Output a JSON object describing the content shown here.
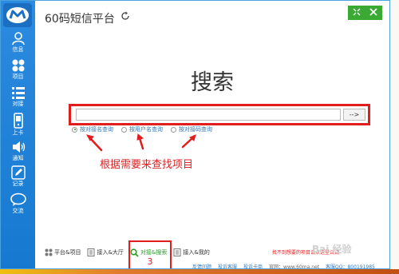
{
  "app": {
    "title": "60码短信平台"
  },
  "sidebar": {
    "items": [
      {
        "label": "信息",
        "icon": "user-icon"
      },
      {
        "label": "项目",
        "icon": "grid-icon"
      },
      {
        "label": "对接",
        "icon": "list-icon"
      },
      {
        "label": "上卡",
        "icon": "phone-icon"
      },
      {
        "label": "通知",
        "icon": "speaker-icon"
      },
      {
        "label": "记录",
        "icon": "edit-icon"
      },
      {
        "label": "交流",
        "icon": "chat-icon"
      }
    ]
  },
  "window_controls": [
    "minimize-icon",
    "close-icon"
  ],
  "main": {
    "heading": "搜索",
    "search": {
      "value": "",
      "button_label": "-->"
    },
    "radios": [
      {
        "label": "按对接名查询",
        "checked": true
      },
      {
        "label": "按用户名查询",
        "checked": false
      },
      {
        "label": "按对接码查询",
        "checked": false
      }
    ],
    "annotation": "根据需要来查找项目"
  },
  "bottom_bar": {
    "items": [
      {
        "label": "平台&项目",
        "active": false
      },
      {
        "label": "接入&大厅",
        "active": false
      },
      {
        "label": "对接&搜索",
        "active": true
      },
      {
        "label": "接入&我的",
        "active": false
      }
    ],
    "step_number": "3",
    "notice": "找不到想要的项目请点这里试试"
  },
  "footer": {
    "links": [
      "反馈问题",
      "投诉客服",
      "投诉卡商"
    ],
    "website": "官网：www.60ma.net",
    "qq": "客服QQ：800191985"
  },
  "watermark": "Bai 经验",
  "colors": {
    "accent": "#1679cf",
    "alert": "#e21d1d",
    "success": "#3aaa35"
  }
}
